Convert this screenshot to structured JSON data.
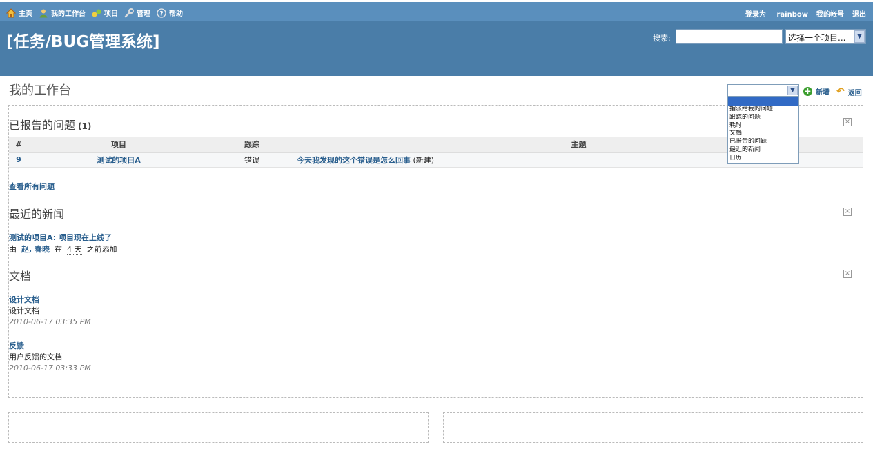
{
  "topbar": {
    "menu": [
      {
        "label": "主页",
        "icon": "home-icon"
      },
      {
        "label": "我的工作台",
        "icon": "user-icon"
      },
      {
        "label": "项目",
        "icon": "projects-icon"
      },
      {
        "label": "管理",
        "icon": "wrench-icon"
      },
      {
        "label": "帮助",
        "icon": "help-icon"
      }
    ],
    "logged_in_as": "登录为",
    "username": "rainbow",
    "my_account": "我的帐号",
    "logout": "退出"
  },
  "header": {
    "title": "[任务/BUG管理系统]",
    "search_label": "搜索:",
    "search_value": "",
    "project_select": "选择一个项目..."
  },
  "page": {
    "title": "我的工作台",
    "add_label": "新增",
    "back_label": "返回"
  },
  "block_dropdown": {
    "selected": "",
    "options": [
      "指派给我的问题",
      "跟踪的问题",
      "耗时",
      "文档",
      "已报告的问题",
      "最近的新闻",
      "日历"
    ]
  },
  "reported_issues": {
    "title": "已报告的问题",
    "count": "(1)",
    "columns": [
      "#",
      "项目",
      "跟踪",
      "主题"
    ],
    "rows": [
      {
        "id": "9",
        "project": "测试的项目A",
        "tracker": "错误",
        "subject": "今天我发现的这个错误是怎么回事",
        "status": "(新建)"
      }
    ],
    "view_all": "查看所有问题"
  },
  "news": {
    "title": "最近的新闻",
    "item_title": "测试的项目A: 项目现在上线了",
    "by": "由",
    "author": "赵, 春晓",
    "at": "在",
    "ago": "4 天",
    "suffix": "之前添加"
  },
  "documents": {
    "title": "文档",
    "items": [
      {
        "title": "设计文档",
        "desc": "设计文档",
        "date": "2010-06-17 03:35 PM"
      },
      {
        "title": "反馈",
        "desc": "用户反馈的文档",
        "date": "2010-06-17 03:33 PM"
      }
    ]
  },
  "colors": {
    "topbar": "#5a8fbd",
    "header": "#4a7da8",
    "link": "#2a5f8e"
  }
}
